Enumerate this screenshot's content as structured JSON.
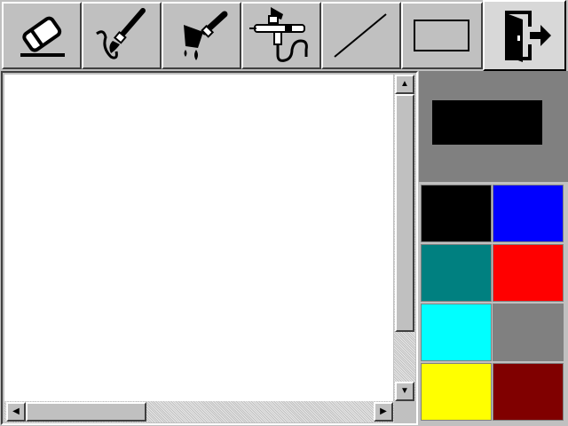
{
  "toolbar": {
    "tools": [
      {
        "name": "eraser",
        "icon": "eraser-icon",
        "active": false
      },
      {
        "name": "brush",
        "icon": "paintbrush-icon",
        "active": false
      },
      {
        "name": "fill",
        "icon": "paint-bucket-icon",
        "active": false
      },
      {
        "name": "airbrush",
        "icon": "airbrush-icon",
        "active": false
      },
      {
        "name": "line",
        "icon": "line-icon",
        "active": false
      },
      {
        "name": "rectangle",
        "icon": "rectangle-icon",
        "active": false
      },
      {
        "name": "exit",
        "icon": "exit-door-icon",
        "active": true
      }
    ]
  },
  "canvas": {
    "background": "#ffffff",
    "vscroll_position": 0.0,
    "hscroll_position": 0.0
  },
  "scrollbar": {
    "up_glyph": "▲",
    "down_glyph": "▼",
    "left_glyph": "◀",
    "right_glyph": "▶"
  },
  "palette": {
    "current_color": "#000000",
    "panel_background": "#808080",
    "colors": [
      "#000000",
      "#0000ff",
      "#008080",
      "#ff0000",
      "#00ffff",
      "#808080",
      "#ffff00",
      "#800000"
    ]
  }
}
